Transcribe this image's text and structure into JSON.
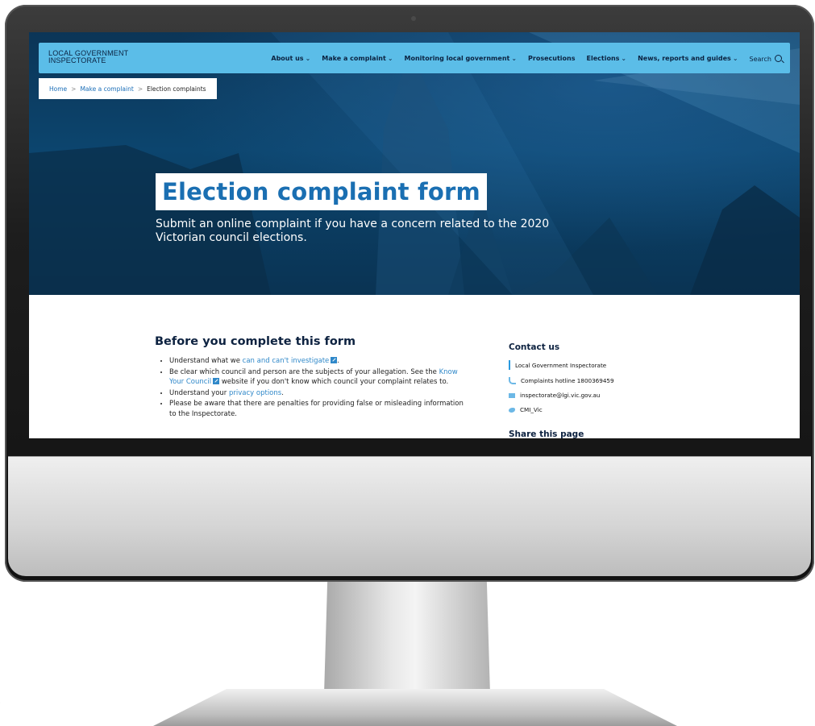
{
  "caption": "orm",
  "site": {
    "logo_line1": "LOCAL GOVERNMENT",
    "logo_line2": "INSPECTORATE"
  },
  "nav": {
    "items": [
      {
        "label": "About us"
      },
      {
        "label": "Make a complaint"
      },
      {
        "label": "Monitoring local government"
      },
      {
        "label": "Prosecutions"
      },
      {
        "label": "Elections"
      },
      {
        "label": "News, reports and guides"
      }
    ],
    "search_label": "Search"
  },
  "breadcrumb": {
    "home": "Home",
    "parent": "Make a complaint",
    "current": "Election complaints",
    "separator": ">"
  },
  "hero": {
    "title": "Election complaint form",
    "subtitle": "Submit an online complaint if you have a concern related to the 2020 Victorian council elections."
  },
  "main": {
    "heading": "Before you complete this form",
    "bullet1_pre": "Understand what we ",
    "bullet1_link": "can and can't investigate",
    "bullet1_post": ".",
    "bullet2_pre": "Be clear which council and person are the subjects of your allegation. See the ",
    "bullet2_link": "Know Your Council",
    "bullet2_post": " website if you don't know which council your complaint relates to.",
    "bullet3_pre": "Understand your ",
    "bullet3_link": "privacy options",
    "bullet3_post": ".",
    "bullet4": "Please be aware that there are penalties for providing false or misleading information to the Inspectorate."
  },
  "sidebar": {
    "contact_heading": "Contact us",
    "org": "Local Government Inspectorate",
    "hotline": "Complaints hotline 1800369459",
    "email": "inspectorate@lgi.vic.gov.au",
    "twitter": "CMI_Vic",
    "share_heading": "Share this page"
  },
  "colors": {
    "nav_bg": "#5bbde8",
    "title_blue": "#1a6fb2",
    "link_blue": "#2f88c9",
    "dark_navy": "#0d2240"
  }
}
